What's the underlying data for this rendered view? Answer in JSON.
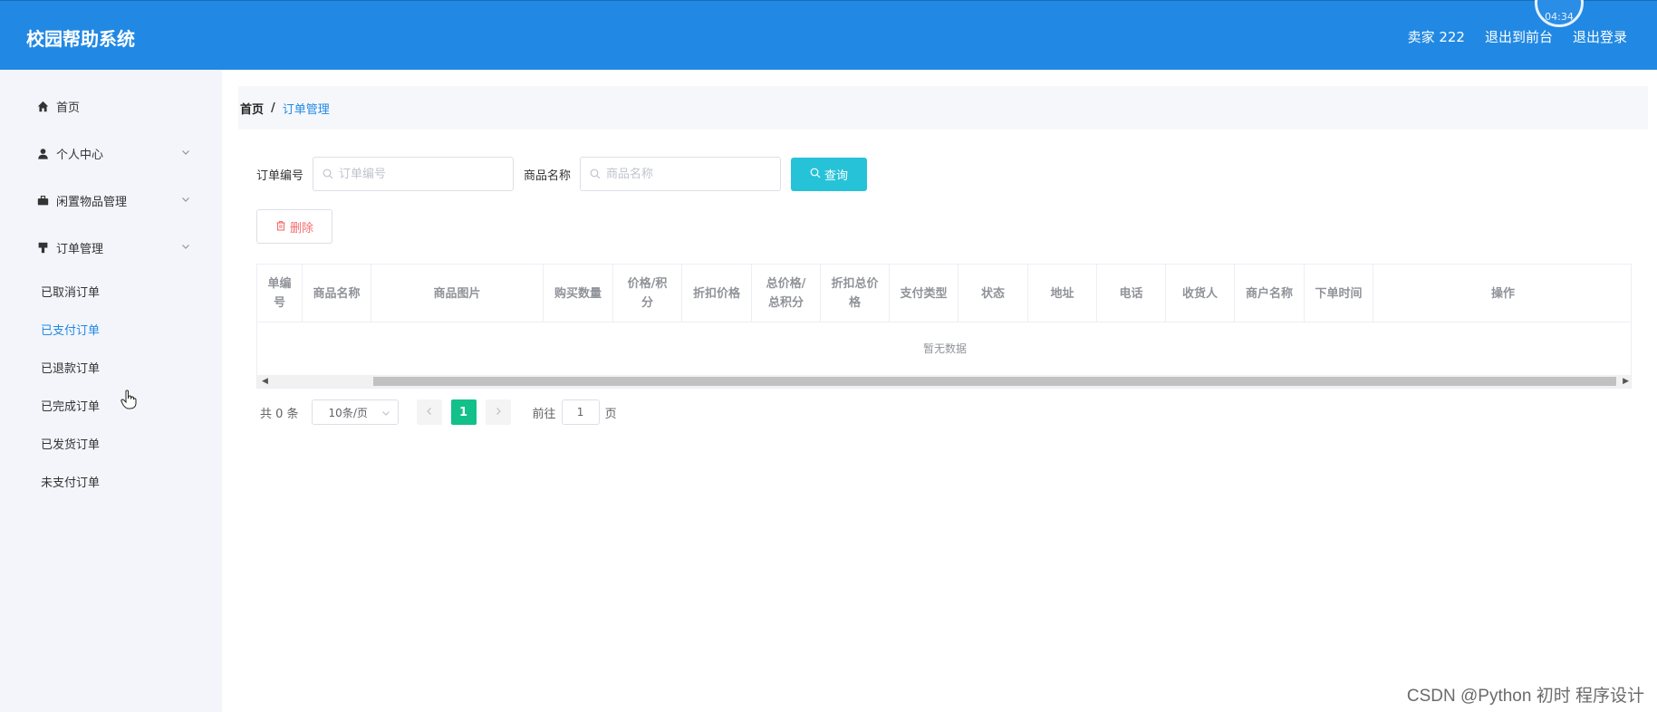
{
  "header": {
    "title": "校园帮助系统",
    "user": "卖家 222",
    "back_to_front": "退出到前台",
    "logout": "退出登录",
    "clock_text": "04:34"
  },
  "sidebar": {
    "items": [
      {
        "label": "首页",
        "icon": "home-icon"
      },
      {
        "label": "个人中心",
        "icon": "user-icon"
      },
      {
        "label": "闲置物品管理",
        "icon": "briefcase-icon"
      },
      {
        "label": "订单管理",
        "icon": "order-icon"
      }
    ],
    "sub_items": [
      {
        "label": "已取消订单",
        "active": false
      },
      {
        "label": "已支付订单",
        "active": true
      },
      {
        "label": "已退款订单",
        "active": false
      },
      {
        "label": "已完成订单",
        "active": false
      },
      {
        "label": "已发货订单",
        "active": false
      },
      {
        "label": "未支付订单",
        "active": false
      }
    ]
  },
  "breadcrumb": {
    "home": "首页",
    "separator": "/",
    "current": "订单管理"
  },
  "search": {
    "order_no_label": "订单编号",
    "order_no_placeholder": "订单编号",
    "product_name_label": "商品名称",
    "product_name_placeholder": "商品名称",
    "query_label": "查询"
  },
  "actions": {
    "delete_label": "删除"
  },
  "table": {
    "columns": [
      "单编号",
      "商品名称",
      "商品图片",
      "购买数量",
      "价格/积\n分",
      "折扣价格",
      "总价格/\n总积分",
      "折扣总价\n格",
      "支付类型",
      "状态",
      "地址",
      "电话",
      "收货人",
      "商户名称",
      "下单时间",
      "操作"
    ],
    "empty_text": "暂无数据"
  },
  "pagination": {
    "total": "共 0 条",
    "page_size": "10条/页",
    "current_page": "1",
    "goto_label": "前往",
    "goto_value": "1",
    "page_suffix": "页"
  },
  "watermark": "CSDN @Python 初时 程序设计",
  "colors": {
    "header_bg": "#2189e3",
    "query_button": "#26c2d8",
    "active_page": "#13c08a",
    "delete_text": "#f56c6c",
    "link_active": "#2189e3"
  }
}
